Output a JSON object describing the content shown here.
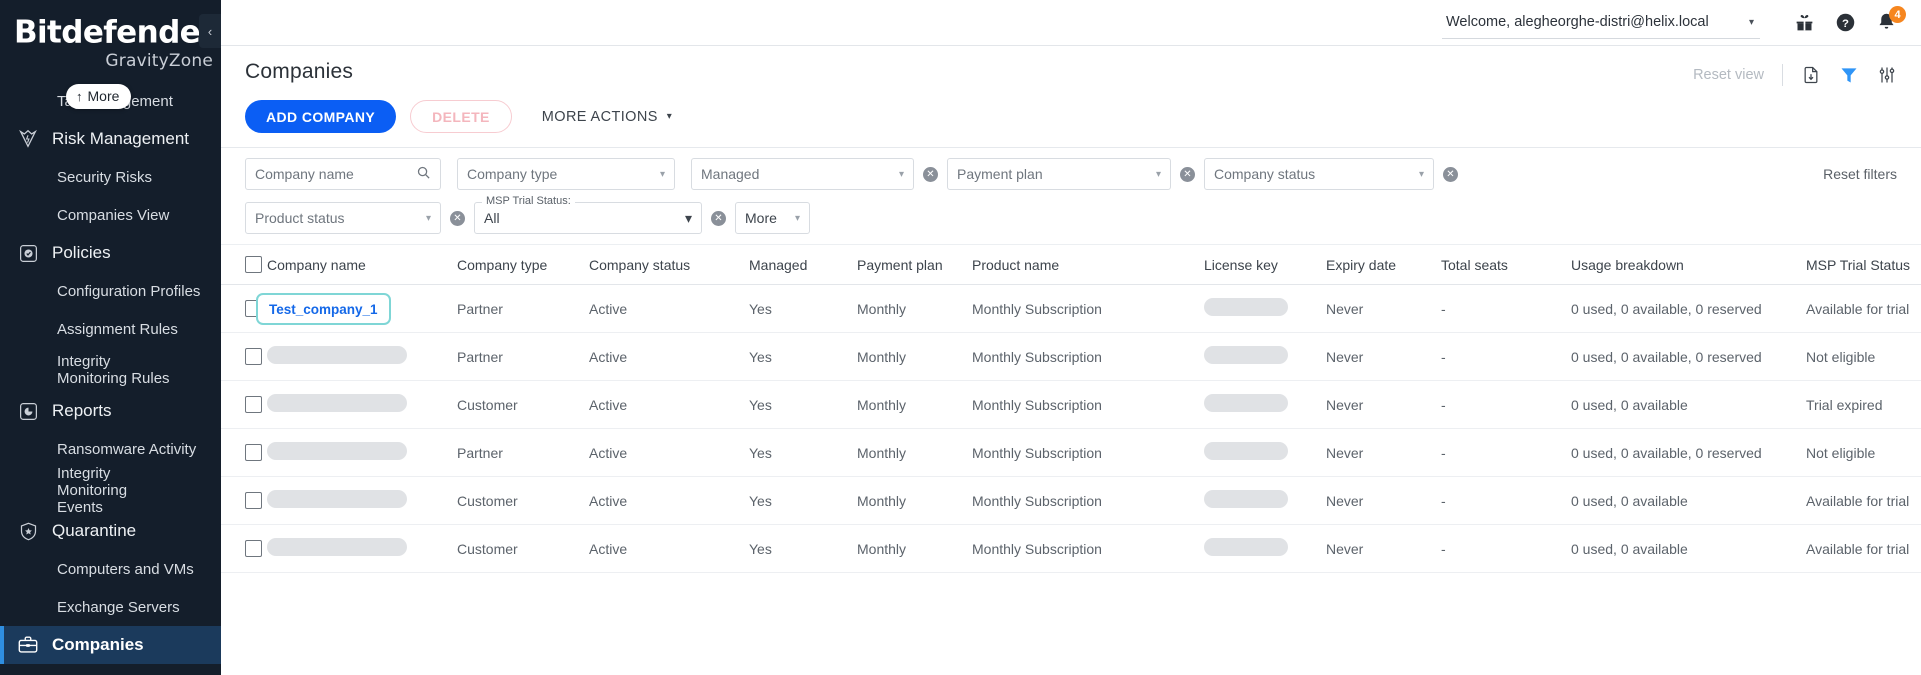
{
  "sidebar": {
    "brand": {
      "name": "Bitdefender",
      "reg": "®",
      "sub": "GravityZone"
    },
    "tooltip": {
      "arrow": "↑",
      "label": "More"
    },
    "collapse_label": "‹",
    "items": [
      {
        "label": "Tag Management",
        "level": "sub",
        "icon": "tag-icon",
        "active": false
      },
      {
        "label": "Risk Management",
        "level": "top",
        "icon": "risk-shield-icon",
        "active": false
      },
      {
        "label": "Security Risks",
        "level": "sub",
        "icon": "",
        "active": false
      },
      {
        "label": "Companies View",
        "level": "sub",
        "icon": "",
        "active": false
      },
      {
        "label": "Policies",
        "level": "top",
        "icon": "policy-check-icon",
        "active": false
      },
      {
        "label": "Configuration Profiles",
        "level": "sub",
        "icon": "",
        "active": false
      },
      {
        "label": "Assignment Rules",
        "level": "sub",
        "icon": "",
        "active": false
      },
      {
        "label": "Integrity Monitoring Rules",
        "level": "sub2",
        "icon": "",
        "active": false
      },
      {
        "label": "Reports",
        "level": "top",
        "icon": "reports-icon",
        "active": false
      },
      {
        "label": "Ransomware Activity",
        "level": "sub",
        "icon": "",
        "active": false
      },
      {
        "label": "Integrity Monitoring Events",
        "level": "sub2",
        "icon": "",
        "active": false
      },
      {
        "label": "Quarantine",
        "level": "top",
        "icon": "quarantine-shield-icon",
        "active": false
      },
      {
        "label": "Computers and VMs",
        "level": "sub",
        "icon": "",
        "active": false
      },
      {
        "label": "Exchange Servers",
        "level": "sub",
        "icon": "",
        "active": false
      },
      {
        "label": "Companies",
        "level": "top",
        "icon": "briefcase-icon",
        "active": true
      }
    ]
  },
  "topbar": {
    "welcome": "Welcome, alegheorghe-distri@helix.local",
    "caret": "▾",
    "icons": [
      {
        "name": "gift-icon"
      },
      {
        "name": "help-icon"
      },
      {
        "name": "notifications-icon",
        "badge": "4"
      }
    ]
  },
  "page": {
    "title": "Companies",
    "reset_view": "Reset view",
    "head_icons": [
      {
        "name": "export-file-icon"
      },
      {
        "name": "filter-funnel-icon"
      },
      {
        "name": "settings-sliders-icon"
      }
    ]
  },
  "toolbar": {
    "add_company": "ADD COMPANY",
    "delete": "DELETE",
    "more_actions": "MORE ACTIONS",
    "more_actions_caret": "▾"
  },
  "filters": {
    "reset_filters": "Reset filters",
    "row1": [
      {
        "name": "company-name-filter",
        "value": "Company name",
        "kind": "search",
        "clear": false
      },
      {
        "name": "company-type-filter",
        "value": "Company type",
        "kind": "select",
        "clear": false
      },
      {
        "name": "managed-filter",
        "value": "Managed",
        "kind": "select",
        "clear": true
      },
      {
        "name": "payment-plan-filter",
        "value": "Payment plan",
        "kind": "select",
        "clear": true
      },
      {
        "name": "company-status-filter",
        "value": "Company status",
        "kind": "select",
        "clear": true
      }
    ],
    "row2": [
      {
        "name": "product-status-filter",
        "value": "Product status",
        "kind": "select",
        "clear": true
      },
      {
        "name": "msp-trial-status-filter",
        "legend": "MSP Trial Status:",
        "value": "All",
        "kind": "legend-select",
        "clear": true
      },
      {
        "name": "more-filters",
        "value": "More",
        "kind": "small-select",
        "clear": false
      }
    ]
  },
  "table": {
    "columns": [
      "Company name",
      "Company type",
      "Company status",
      "Managed",
      "Payment plan",
      "Product name",
      "License key",
      "Expiry date",
      "Total seats",
      "Usage breakdown",
      "MSP Trial Status"
    ],
    "rows": [
      {
        "name": "Test_company_1",
        "name_redacted": false,
        "highlight": true,
        "type": "Partner",
        "status": "Active",
        "managed": "Yes",
        "payment": "Monthly",
        "product": "Monthly Subscription",
        "license": "",
        "expiry": "Never",
        "seats": "-",
        "usage": "0 used, 0 available, 0 reserved",
        "msp": "Available for trial"
      },
      {
        "name": "",
        "name_redacted": true,
        "highlight": false,
        "type": "Partner",
        "status": "Active",
        "managed": "Yes",
        "payment": "Monthly",
        "product": "Monthly Subscription",
        "license": "",
        "expiry": "Never",
        "seats": "-",
        "usage": "0 used, 0 available, 0 reserved",
        "msp": "Not eligible"
      },
      {
        "name": "",
        "name_redacted": true,
        "highlight": false,
        "type": "Customer",
        "status": "Active",
        "managed": "Yes",
        "payment": "Monthly",
        "product": "Monthly Subscription",
        "license": "",
        "expiry": "Never",
        "seats": "-",
        "usage": "0 used, 0 available",
        "msp": "Trial expired"
      },
      {
        "name": "",
        "name_redacted": true,
        "highlight": false,
        "type": "Partner",
        "status": "Active",
        "managed": "Yes",
        "payment": "Monthly",
        "product": "Monthly Subscription",
        "license": "",
        "expiry": "Never",
        "seats": "-",
        "usage": "0 used, 0 available, 0 reserved",
        "msp": "Not eligible"
      },
      {
        "name": "",
        "name_redacted": true,
        "highlight": false,
        "type": "Customer",
        "status": "Active",
        "managed": "Yes",
        "payment": "Monthly",
        "product": "Monthly Subscription",
        "license": "",
        "expiry": "Never",
        "seats": "-",
        "usage": "0 used, 0 available",
        "msp": "Available for trial"
      },
      {
        "name": "",
        "name_redacted": true,
        "highlight": false,
        "type": "Customer",
        "status": "Active",
        "managed": "Yes",
        "payment": "Monthly",
        "product": "Monthly Subscription",
        "license": "",
        "expiry": "Never",
        "seats": "-",
        "usage": "0 used, 0 available",
        "msp": "Available for trial"
      }
    ]
  },
  "colors": {
    "sidebar_bg": "#141e2b",
    "accent_blue": "#0b5ef4",
    "active_nav": "#1b3a5c",
    "badge_orange": "#f6861f",
    "highlight_teal": "#7fd6d6",
    "link_blue": "#1468e8"
  }
}
